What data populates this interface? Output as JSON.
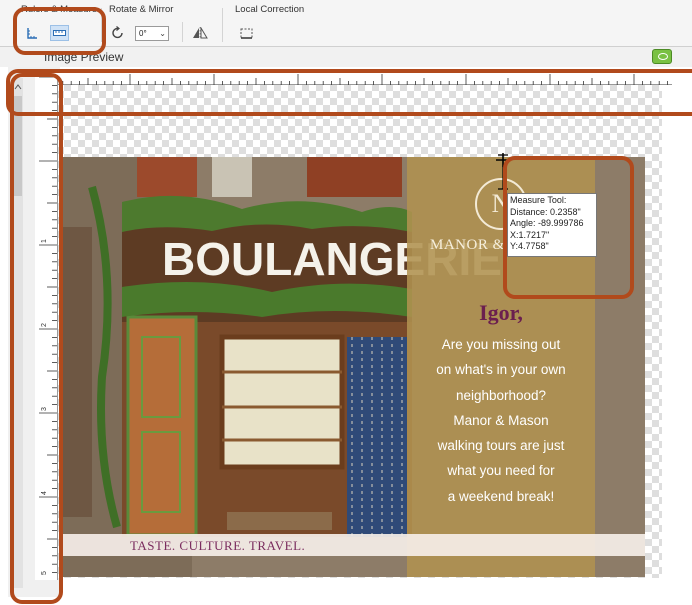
{
  "toolbar": {
    "rulers_measure": {
      "title": "Rulers & Measure",
      "buttons": [
        "ruler-icon",
        "measure-tool-icon"
      ]
    },
    "rotate_mirror": {
      "title": "Rotate & Mirror",
      "angle_value": "0°"
    },
    "local_correction": {
      "title": "Local Correction"
    }
  },
  "preview": {
    "title": "Image Preview"
  },
  "flyer": {
    "storefront_sign": "BOULANGERIE",
    "monogram": "N",
    "brand": "MANOR &",
    "greeting": "Igor,",
    "pitch_lines": [
      "Are you missing out",
      "on what's in your own",
      "neighborhood?",
      "Manor & Mason",
      "walking tours are just",
      "what you need for",
      "a weekend break!"
    ],
    "tagline": "TASTE.     CULTURE.     TRAVEL."
  },
  "measure_tooltip": {
    "title": "Measure Tool:",
    "distance": "Distance: 0.2358\"",
    "angle": "Angle: -89.999786",
    "x": "X:1.7217\"",
    "y": "Y:4.7758\""
  },
  "vertical_ruler_labels": [
    "1",
    "2",
    "3",
    "4",
    "5"
  ],
  "colors": {
    "highlight": "#b14a1c",
    "gold_panel": "#b09250",
    "greeting": "#6b1f4f",
    "tagline": "#7b2d5f",
    "preview_toggle": "#7ac143"
  }
}
